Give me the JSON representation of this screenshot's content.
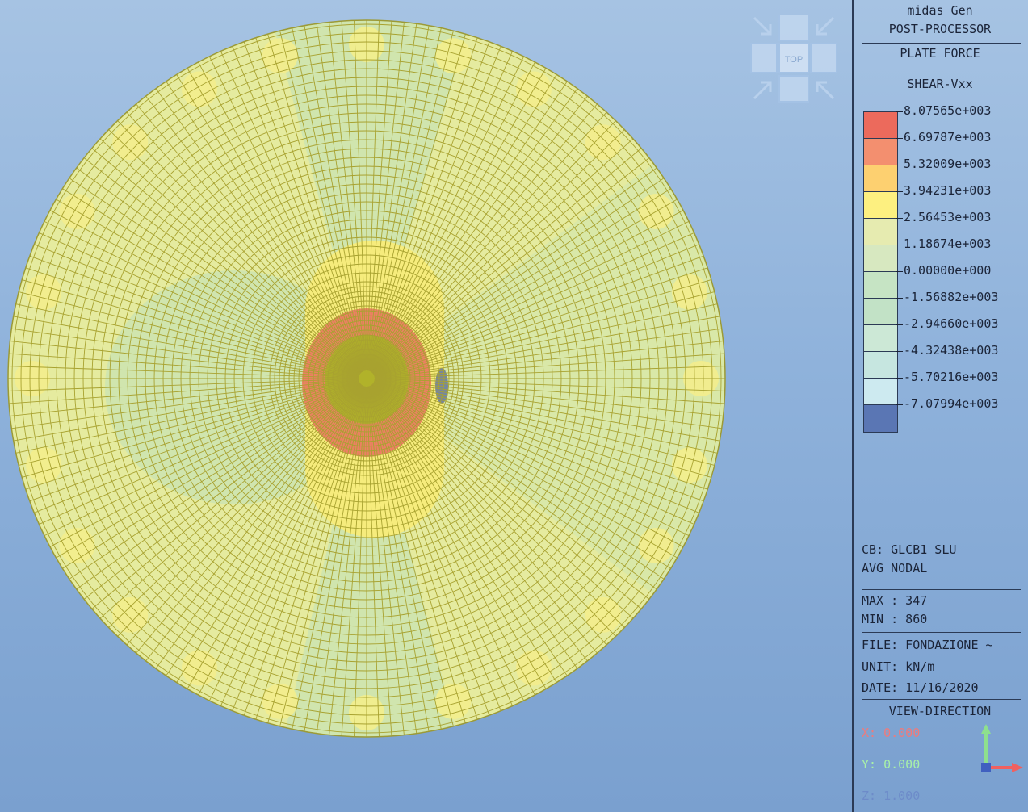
{
  "panel": {
    "app": "midas Gen",
    "mode": "POST-PROCESSOR",
    "result_type": "PLATE FORCE",
    "component": "SHEAR-Vxx",
    "combination": "CB: GLCB1 SLU",
    "averaging": "AVG NODAL",
    "max": "MAX : 347",
    "min": "MIN : 860",
    "file": "FILE: FONDAZIONE ~",
    "unit": "UNIT: kN/m",
    "date": "DATE: 11/16/2020",
    "view_direction_title": "VIEW-DIRECTION",
    "view_x": "X: 0.000",
    "view_y": "Y: 0.000",
    "view_z": "Z: 1.000"
  },
  "legend": {
    "values": [
      "8.07565e+003",
      "6.69787e+003",
      "5.32009e+003",
      "3.94231e+003",
      "2.56453e+003",
      "1.18674e+003",
      "0.00000e+000",
      "-1.56882e+003",
      "-2.94660e+003",
      "-4.32438e+003",
      "-5.70216e+003",
      "-7.07994e+003"
    ],
    "colors": [
      "#ec6a5c",
      "#f38f6f",
      "#fdd070",
      "#fdf080",
      "#e6ebb0",
      "#d7e8c0",
      "#c6e4c4",
      "#c2e2c6",
      "#cce8d6",
      "#c6e6e0",
      "#cdeaf0",
      "#5a76b4"
    ]
  },
  "navcube": {
    "label": "TOP"
  },
  "contour_colors": {
    "outer": "#e5eb9f",
    "green_zone": "#d0e5ae",
    "yellow_zone": "#f6ec7c",
    "red_zone": "#ec8063",
    "core": "#b1b22a",
    "mesh": "#a8a230"
  },
  "axis_colors": {
    "x": "#f06060",
    "y": "#8ee08e",
    "z": "#4060c0"
  }
}
